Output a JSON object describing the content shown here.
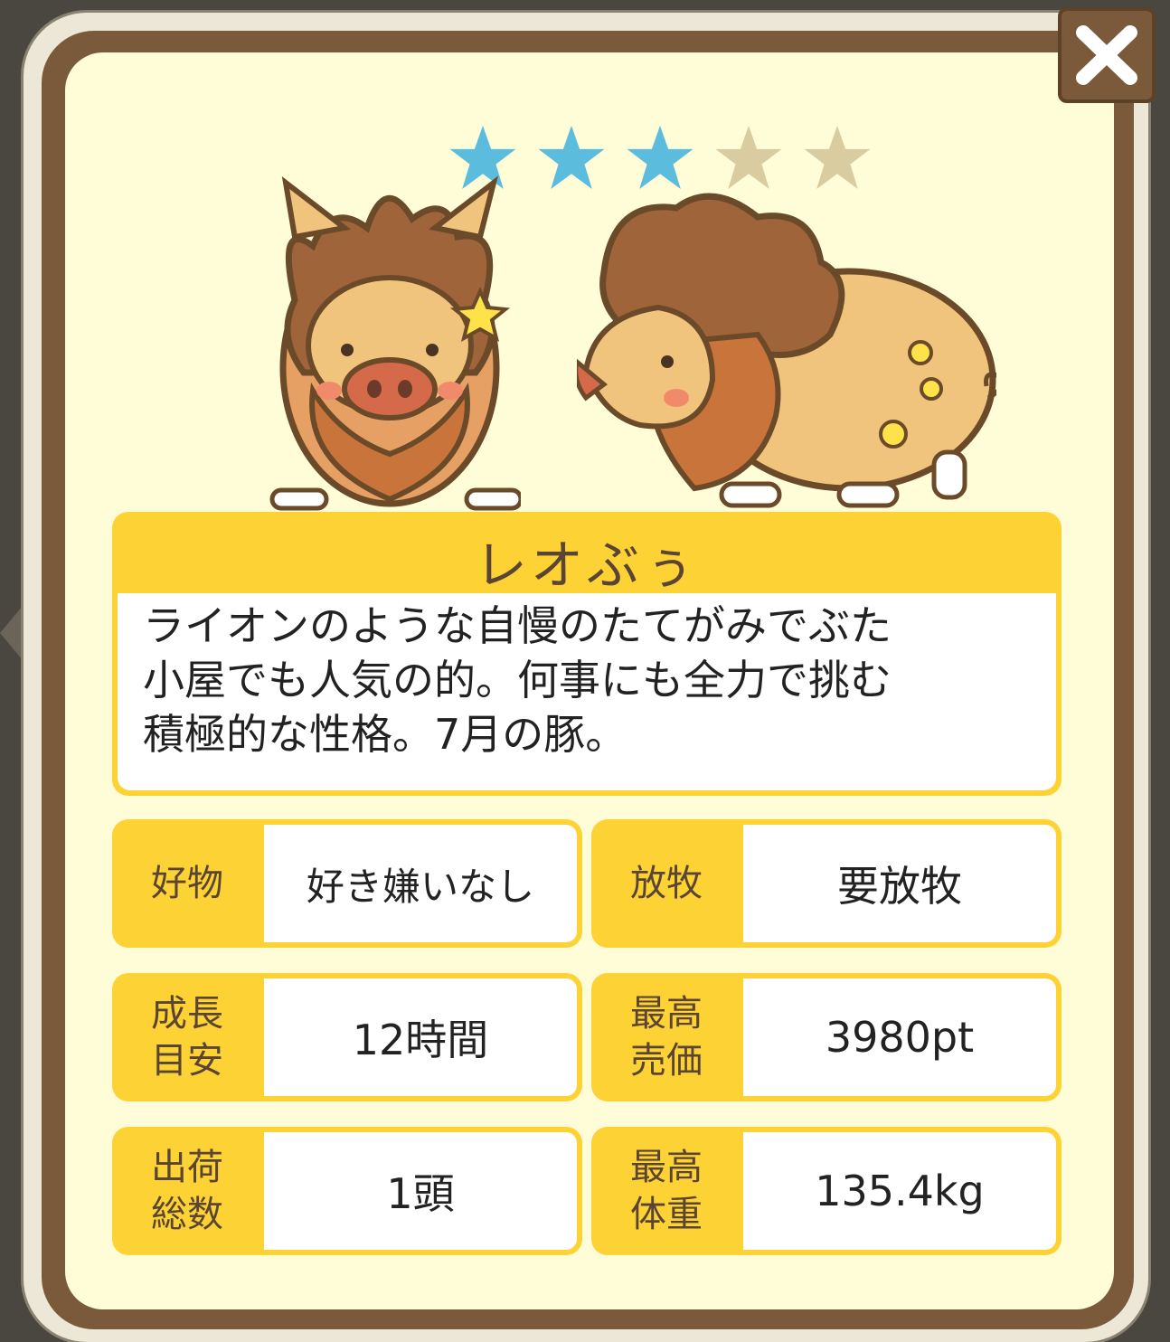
{
  "rating": {
    "filled": 3,
    "total": 5,
    "filled_color": "#5bbcdd",
    "empty_color": "#d9cca0"
  },
  "pig": {
    "name": "レオぶぅ",
    "description_lines": [
      "ライオンのような自慢のたてがみでぶた",
      "小屋でも人気の的。何事にも全力で挑む",
      "積極的な性格。7月の豚。"
    ]
  },
  "stats": {
    "favorite": {
      "label": "好物",
      "value": "好き嫌いなし"
    },
    "grazing": {
      "label": "放牧",
      "value": "要放牧"
    },
    "growth": {
      "label_line1": "成長",
      "label_line2": "目安",
      "value": "12時間"
    },
    "max_price": {
      "label_line1": "最高",
      "label_line2": "売価",
      "value": "3980pt"
    },
    "shipped": {
      "label_line1": "出荷",
      "label_line2": "総数",
      "value": "1頭"
    },
    "max_weight": {
      "label_line1": "最高",
      "label_line2": "体重",
      "value": "135.4kg"
    }
  },
  "icons": {
    "close": "close-icon",
    "star": "star-icon",
    "zodiac": "leo-symbol-icon"
  }
}
